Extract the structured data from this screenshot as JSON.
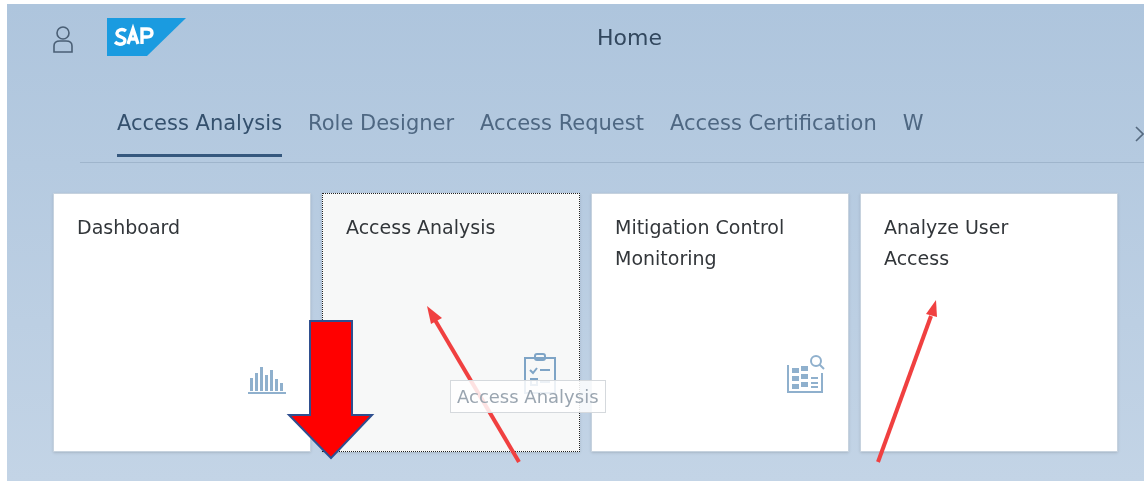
{
  "header": {
    "title": "Home"
  },
  "tabs": [
    {
      "label": "Access Analysis",
      "selected": true
    },
    {
      "label": "Role Designer",
      "selected": false
    },
    {
      "label": "Access Request",
      "selected": false
    },
    {
      "label": "Access Certification",
      "selected": false
    },
    {
      "label": "W",
      "selected": false
    }
  ],
  "tiles": [
    {
      "title": "Dashboard",
      "focused": false
    },
    {
      "title": "Access Analysis",
      "focused": true
    },
    {
      "title": "Mitigation Control Monitoring",
      "focused": false
    },
    {
      "title": "Analyze User Access",
      "focused": false
    }
  ],
  "tooltip": {
    "text": "Access Analysis"
  }
}
